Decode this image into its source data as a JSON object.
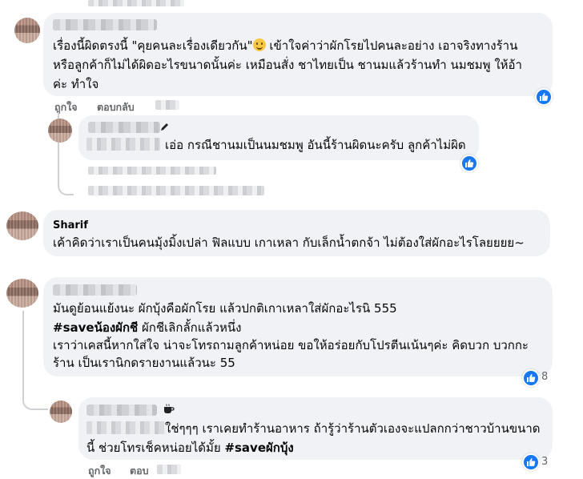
{
  "comments": [
    {
      "name": "",
      "lines": [
        "เรื่องนี้ผิดตรงนี้ \"คุยคนละเรื่องเดียวกัน\"",
        " เข้าใจค่าว่าผักโรยไปคนละอย่าง เอาจริงทางร้าน",
        "หรือลูกค้าก็ไม่ได้ผิดอะไรขนาดนั้นค่ะ เหมือนสั่ง ชาไทยเป็น ชานมแล้วร้านทำ นมชมพู ให้อ้า",
        "ค่ะ ทำใจ"
      ],
      "emoji": "grinning-face",
      "actions": {
        "like": "ถูกใจ",
        "reply": "ตอบกลับ"
      }
    },
    {
      "name": "",
      "lines": [
        "เอ่อ กรณีชานมเป็นนมชมพู อันนี้ร้านผิดนะครับ ลูกค้าไม่ผิด"
      ],
      "icon": "pen-icon"
    },
    {
      "name": "Sharif",
      "lines": [
        "เค้าคิดว่าเราเป็นคนมุ้งมิ้งเปล่า ฟิลแบบ เกาเหลา กับเล็กน้ำตกจ้า ไม่ต้องใส่ผักอะไรโลยยยย~"
      ]
    },
    {
      "name": "",
      "lines": [
        "มันดูย้อนแย้งนะ ผักบุ้งคือผักโรย แล้วปกติเกาเหลาใส่ผักอะไรนิ 555",
        "#saveน้องผักชี",
        " ผักชีเลิกลั้กแล้วหนึ่ง",
        "เราว่าเคสนี้หากใส่ใจ น่าจะโทรถามลูกค้าหน่อย ขอให้อร่อยกับโปรตีนเน้นๆค่ะ คิดบวก บวกกะ",
        "ร้าน เป็นเรานิกดรายงานแล้วนะ 55"
      ],
      "reactions": "8"
    },
    {
      "name": "",
      "lines": [
        " ใช่ๆๆๆ เราเคยทำร้านอาหาร ถ้ารู้ว่าร้านตัวเองจะแปลกกว่าชาวบ้านขนาด",
        "นี้ ช่วยโทรเช็คหน่อยได้มั้ย ",
        "#saveผักบุ้ง"
      ],
      "icon": "coffee-icon",
      "reactions": "3",
      "actions": {
        "like": "ถูกใจ",
        "reply": "ตอบ"
      }
    }
  ],
  "colors": {
    "like_blue": "#1877f2",
    "bubble": "#f0f2f5",
    "muted": "#65676b"
  }
}
